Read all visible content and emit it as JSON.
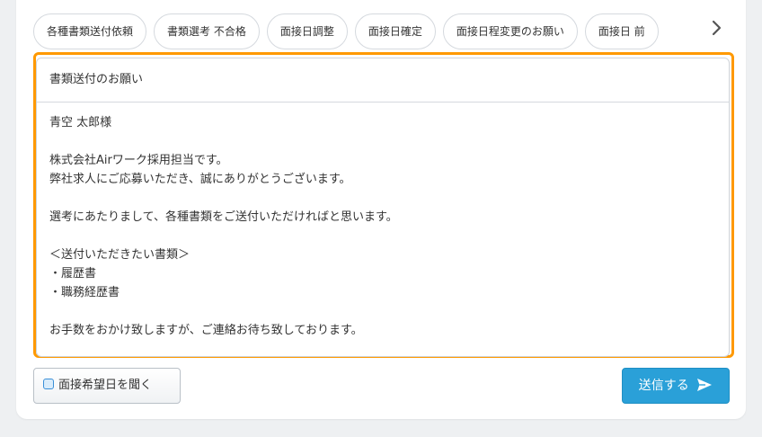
{
  "templates": {
    "chips": [
      "各種書類送付依頼",
      "書類選考 不合格",
      "面接日調整",
      "面接日確定",
      "面接日程変更のお願い",
      "面接日 前"
    ]
  },
  "editor": {
    "subject": "書類送付のお願い",
    "body": {
      "greeting": "青空 太郎様",
      "intro_1": "株式会社Airワーク採用担当です。",
      "intro_2": "弊社求人にご応募いただき、誠にありがとうございます。",
      "request": "選考にあたりまして、各種書類をご送付いただければと思います。",
      "docs_heading": "＜送付いただきたい書類＞",
      "doc_1": "・履歴書",
      "doc_2": "・職務経歴書",
      "closing": "お手数をおかけ致しますが、ご連絡お待ち致しております。"
    }
  },
  "footer": {
    "ask_date_label": "面接希望日を聞く",
    "send_label": "送信する"
  },
  "colors": {
    "focus_ring": "#ff9900",
    "send_button": "#2aa0d8"
  },
  "icons": {
    "scroll_right": "chevron-right-icon",
    "ask_date": "calendar-icon",
    "send": "paper-plane-icon"
  }
}
